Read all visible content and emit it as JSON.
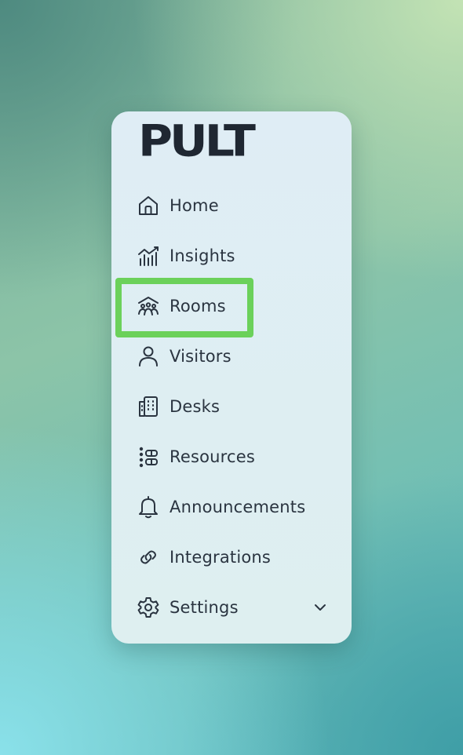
{
  "brand": {
    "logo_text": "PULT"
  },
  "nav": {
    "items": [
      {
        "label": "Home",
        "icon": "home-icon"
      },
      {
        "label": "Insights",
        "icon": "chart-icon"
      },
      {
        "label": "Rooms",
        "icon": "rooms-icon"
      },
      {
        "label": "Visitors",
        "icon": "user-icon"
      },
      {
        "label": "Desks",
        "icon": "desks-icon"
      },
      {
        "label": "Resources",
        "icon": "resources-icon"
      },
      {
        "label": "Announcements",
        "icon": "bell-icon"
      },
      {
        "label": "Integrations",
        "icon": "link-icon"
      },
      {
        "label": "Settings",
        "icon": "gear-icon",
        "expandable": true
      }
    ],
    "highlighted_item": "Rooms"
  },
  "colors": {
    "text": "#2a3440",
    "logo": "#1f2732",
    "highlight": "#6bd15a",
    "panel": "#dfedf5"
  }
}
